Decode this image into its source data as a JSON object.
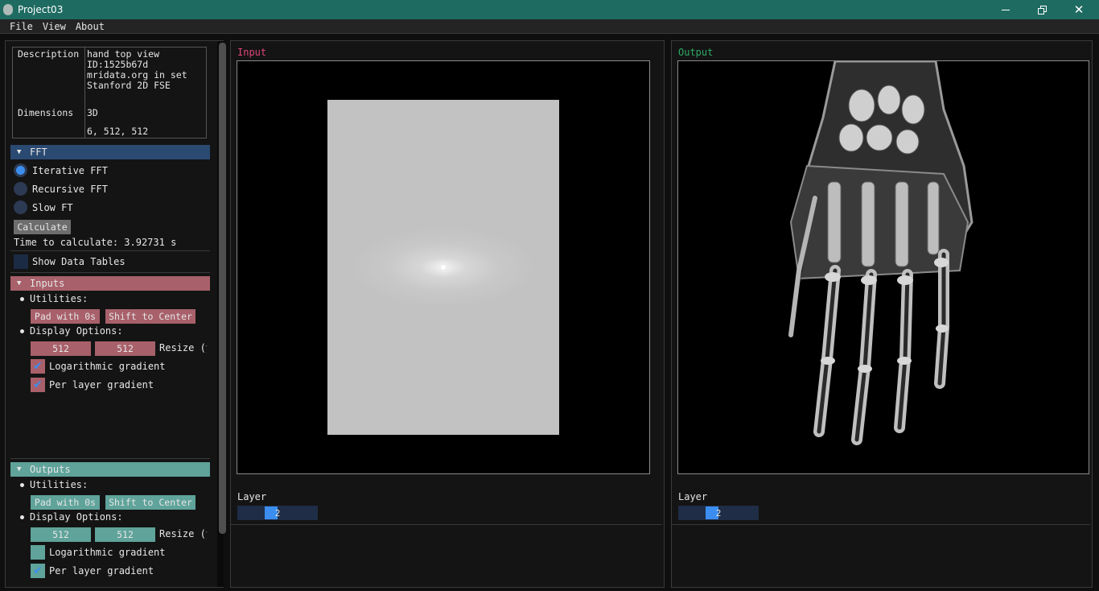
{
  "window": {
    "title": "Project03"
  },
  "menu": {
    "items": [
      "File",
      "View",
      "About"
    ]
  },
  "info": {
    "description_key": "Description",
    "description_lines": [
      "hand top view",
      "ID:1525b67d",
      "mridata.org in set",
      "Stanford 2D FSE"
    ],
    "dimensions_key": "Dimensions",
    "dimensions_type": "3D",
    "dimensions_value": "6, 512, 512"
  },
  "fft": {
    "header": "FFT",
    "options": [
      {
        "label": "Iterative FFT",
        "selected": true
      },
      {
        "label": "Recursive FFT",
        "selected": false
      },
      {
        "label": "Slow FT",
        "selected": false
      }
    ],
    "calculate_label": "Calculate",
    "time_text": "Time to calculate: 3.92731 s",
    "show_tables_label": "Show Data Tables"
  },
  "inputs": {
    "header": "Inputs",
    "utilities_label": "Utilities:",
    "pad_label": "Pad with 0s",
    "shift_label": "Shift to Center",
    "display_label": "Display Options:",
    "width": "512",
    "height": "512",
    "resize_label": "Resize (y",
    "log_label": "Logarithmic gradient",
    "log_checked": true,
    "per_layer_label": "Per layer gradient",
    "per_layer_checked": true
  },
  "outputs": {
    "header": "Outputs",
    "utilities_label": "Utilities:",
    "pad_label": "Pad with 0s",
    "shift_label": "Shift to Center",
    "display_label": "Display Options:",
    "width": "512",
    "height": "512",
    "resize_label": "Resize (y",
    "log_label": "Logarithmic gradient",
    "log_checked": false,
    "per_layer_label": "Per layer gradient",
    "per_layer_checked": true
  },
  "input_view": {
    "title": "Input",
    "layer_label": "Layer",
    "layer_value": "2"
  },
  "output_view": {
    "title": "Output",
    "layer_label": "Layer",
    "layer_value": "2"
  },
  "colors": {
    "titlebar": "#1e6b61",
    "fft_header": "#2a4a72",
    "inputs_accent": "#a8606a",
    "outputs_accent": "#5fa39a",
    "input_title": "#e0457a",
    "output_title": "#2eaa66",
    "radio_selected": "#3b8ef0"
  },
  "icons": [
    "app-icon",
    "minimize-icon",
    "maximize-icon",
    "close-icon",
    "collapse-triangle-icon",
    "checkmark-icon"
  ]
}
